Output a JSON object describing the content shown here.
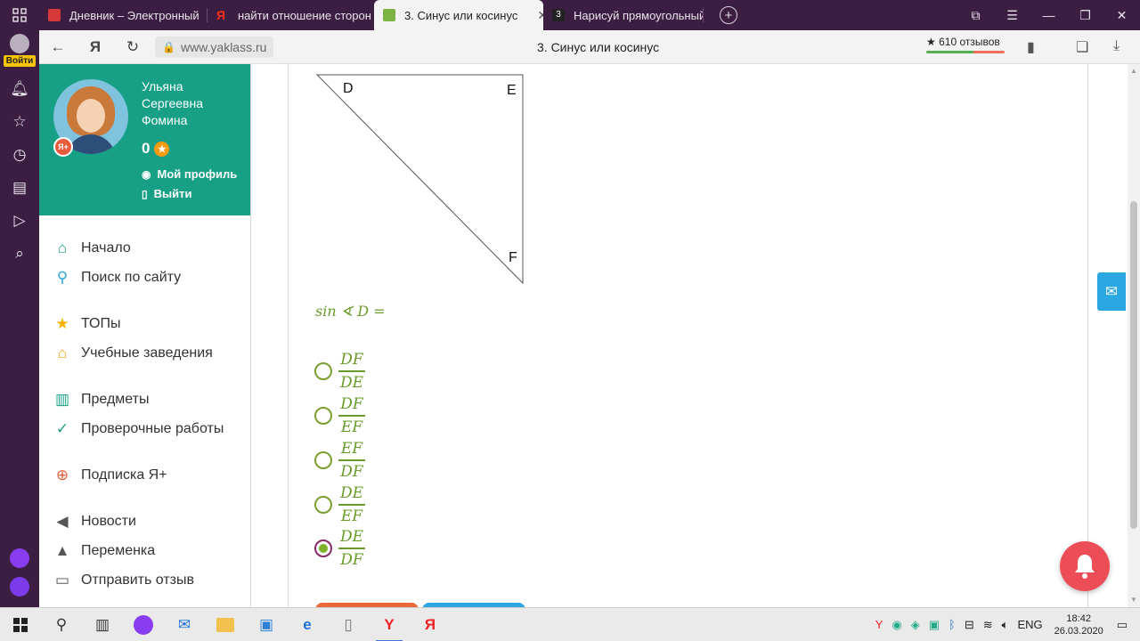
{
  "browser": {
    "tabs": [
      {
        "title": "Дневник – Электронный",
        "fav_color": "#d6393a"
      },
      {
        "title": "найти отношение сторон",
        "fav_color": "#ff2d1a"
      },
      {
        "title": "3. Синус или косинус",
        "fav_color": "#7cb342",
        "active": true,
        "close": "✕"
      },
      {
        "title": "Нарисуй прямоугольный",
        "fav_color": "#222222"
      }
    ],
    "new_tab": "+",
    "url": "www.yaklass.ru",
    "page_title": "3. Синус или косинус",
    "reviews": "★ 610 отзывов",
    "login_label": "Войти"
  },
  "profile": {
    "name": "Ульяна Сергеевна Фомина",
    "points": "0",
    "points_icon": "★",
    "plus_badge": "Я+",
    "my_profile": "Мой профиль",
    "logout": "Выйти"
  },
  "menu": [
    {
      "label": "Начало",
      "icon": "home-icon",
      "color": "#17a085"
    },
    {
      "label": "Поиск по сайту",
      "icon": "search-icon",
      "color": "#2aa6e0"
    },
    {
      "label": "ТОПы",
      "icon": "star-icon",
      "color": "#f6b400"
    },
    {
      "label": "Учебные заведения",
      "icon": "school-icon",
      "color": "#f6a000"
    },
    {
      "label": "Предметы",
      "icon": "book-icon",
      "color": "#17a085"
    },
    {
      "label": "Проверочные работы",
      "icon": "check-circle-icon",
      "color": "#17a085"
    },
    {
      "label": "Подписка Я+",
      "icon": "ya-plus-icon",
      "color": "#e85a3c"
    },
    {
      "label": "Новости",
      "icon": "megaphone-icon",
      "color": "#555555"
    },
    {
      "label": "Переменка",
      "icon": "bell-icon",
      "color": "#555555"
    },
    {
      "label": "Отправить отзыв",
      "icon": "comment-icon",
      "color": "#555555"
    }
  ],
  "figure": {
    "vertex_d": "D",
    "vertex_e": "E",
    "vertex_f": "F"
  },
  "question": {
    "formula": "sin ∢ D ="
  },
  "options": [
    {
      "num": "DF",
      "den": "DE",
      "selected": false
    },
    {
      "num": "DF",
      "den": "EF",
      "selected": false
    },
    {
      "num": "EF",
      "den": "DF",
      "selected": false
    },
    {
      "num": "DE",
      "den": "EF",
      "selected": false
    },
    {
      "num": "DE",
      "den": "DF",
      "selected": true
    }
  ],
  "colors": {
    "brand_green": "#17a085",
    "math_green": "#6a9c2a",
    "notify_red": "#ec4d57",
    "mail_blue": "#2aa6e0"
  },
  "taskbar": {
    "lang": "ENG",
    "time": "18:42",
    "date": "26.03.2020"
  }
}
